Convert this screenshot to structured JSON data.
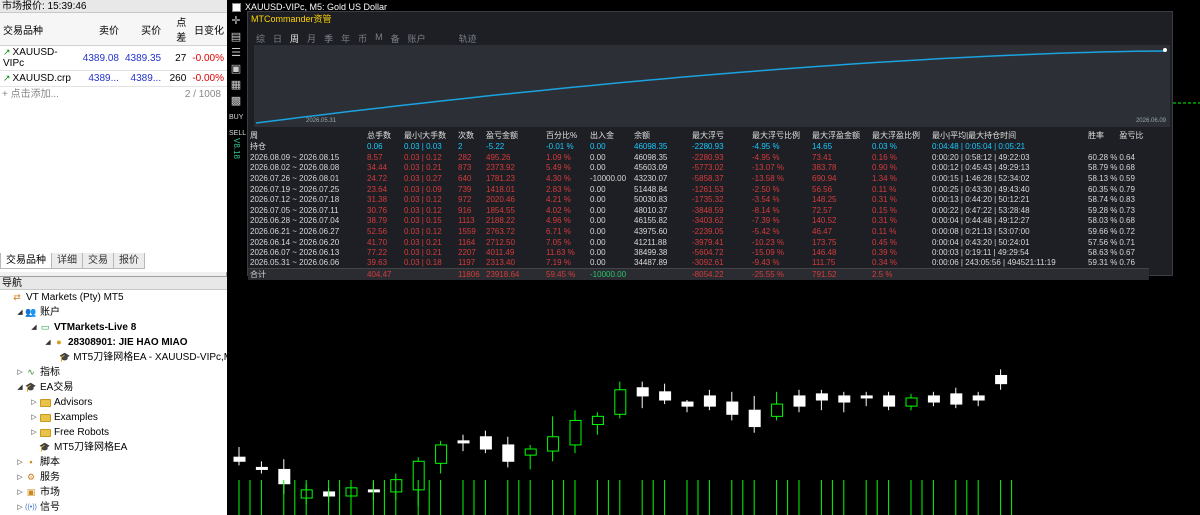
{
  "market_watch": {
    "title": "市场报价: 15:39:46",
    "columns": [
      "交易品种",
      "卖价",
      "买价",
      "点差",
      "日变化"
    ],
    "rows": [
      {
        "symbol": "XAUUSD-VIPc",
        "bid": "4389.08",
        "ask": "4389.35",
        "spread": "27",
        "change": "-0.00%"
      },
      {
        "symbol": "XAUUSD.crp",
        "bid": "4389...",
        "ask": "4389...",
        "spread": "260",
        "change": "-0.00%"
      }
    ],
    "add_label": "点击添加...",
    "count": "2 / 1008",
    "tabs": [
      "交易品种",
      "详细",
      "交易",
      "报价"
    ]
  },
  "navigator": {
    "title": "导航",
    "items": [
      {
        "label": "VT Markets (Pty) MT5",
        "level": 0,
        "icon": "broker-icon"
      },
      {
        "label": "账户",
        "level": 1,
        "icon": "accounts-icon",
        "expand": "▲"
      },
      {
        "label": "VTMarkets-Live 8",
        "level": 2,
        "icon": "server-icon",
        "expand": "▲",
        "bold": true
      },
      {
        "label": "28308901: JIE HAO MIAO",
        "level": 3,
        "icon": "user-icon",
        "expand": "▲",
        "bold": true
      },
      {
        "label": "MT5刀锋网格EA - XAUUSD-VIPc,M",
        "level": 4,
        "icon": "ea-icon"
      },
      {
        "label": "指标",
        "level": 1,
        "icon": "indicator-icon",
        "expand": "▶"
      },
      {
        "label": "EA交易",
        "level": 1,
        "icon": "ea-folder-icon",
        "expand": "▲"
      },
      {
        "label": "Advisors",
        "level": 2,
        "icon": "folder-icon",
        "expand": "▶"
      },
      {
        "label": "Examples",
        "level": 2,
        "icon": "folder-icon",
        "expand": "▶"
      },
      {
        "label": "Free Robots",
        "level": 2,
        "icon": "folder-icon",
        "expand": "▶"
      },
      {
        "label": "MT5刀锋网格EA",
        "level": 2,
        "icon": "ea-icon"
      },
      {
        "label": "脚本",
        "level": 1,
        "icon": "script-icon",
        "expand": "▶"
      },
      {
        "label": "服务",
        "level": 1,
        "icon": "service-icon",
        "expand": "▶"
      },
      {
        "label": "市场",
        "level": 1,
        "icon": "market-icon",
        "expand": "▶"
      },
      {
        "label": "信号",
        "level": 1,
        "icon": "signal-icon",
        "expand": "▶"
      }
    ]
  },
  "chart": {
    "title": "XAUUSD-VIPc, M5:  Gold US Dollar",
    "version": "V8.18",
    "toolstrip": [
      "crosshair-icon",
      "chart-icon",
      "list-icon",
      "expand-icon",
      "calendar-icon",
      "grid-icon"
    ],
    "toolstrip_labels": [
      "BUY",
      "SELL"
    ],
    "colors": {
      "bull": "#00ff00",
      "bear": "#ffffff",
      "equity": "#1aa3e0",
      "loss": "#d63b3b",
      "positive": "#18c9ff"
    }
  },
  "mtc": {
    "title": "MTCommander资管",
    "period_tabs": [
      "综",
      "日",
      "周",
      "月",
      "季",
      "年",
      "币",
      "M",
      "备",
      "账户",
      "轨迹"
    ],
    "active_tab": "周",
    "equity_dates": [
      "2026.05.31",
      "2026.06.09"
    ],
    "headers": [
      "周",
      "总手数",
      "最小|大手数",
      "次数",
      "盈亏金额",
      "百分比%",
      "出入金",
      "余额",
      "最大浮亏",
      "最大浮亏比例",
      "最大浮盈金额",
      "最大浮盈比例",
      "最小|平均|最大持仓时间",
      "胜率",
      "盈亏比"
    ],
    "hold": [
      "持仓",
      "0.06",
      "0.03 | 0.03",
      "2",
      "-5.22",
      "-0.01 %",
      "0.00",
      "46098.35",
      "-2280.93",
      "-4.95 %",
      "14.65",
      "0.03 %",
      "0:04:48 | 0:05:04 | 0:05:21",
      "",
      ""
    ],
    "rows": [
      [
        "2026.08.09 ~ 2026.08.15",
        "8.57",
        "0.03 | 0.12",
        "282",
        "495.26",
        "1.09 %",
        "0.00",
        "46098.35",
        "-2280.93",
        "-4.95 %",
        "73.41",
        "0.16 %",
        "0:00:20 | 0:58:12 | 49:22:03",
        "60.28 %",
        "0.64"
      ],
      [
        "2026.08.02 ~ 2026.08.08",
        "34.44",
        "0.03 | 0.21",
        "873",
        "2373.92",
        "5.49 %",
        "0.00",
        "45603.09",
        "-5773.02",
        "-13.07 %",
        "383.78",
        "0.90 %",
        "0:00:12 | 0:45:43 | 49:29:13",
        "58.79 %",
        "0.68"
      ],
      [
        "2026.07.26 ~ 2026.08.01",
        "24.72",
        "0.03 | 0.27",
        "640",
        "1781.23",
        "4.30 %",
        "-10000.00",
        "43230.07",
        "-5858.37",
        "-13.58 %",
        "690.94",
        "1.34 %",
        "0:00:15 | 1:46:28 | 52:34:02",
        "58.13 %",
        "0.59"
      ],
      [
        "2026.07.19 ~ 2026.07.25",
        "23.64",
        "0.03 | 0.09",
        "739",
        "1418.01",
        "2.83 %",
        "0.00",
        "51448.84",
        "-1261.53",
        "-2.50 %",
        "56.56",
        "0.11 %",
        "0:00:25 | 0:43:30 | 49:43:40",
        "60.35 %",
        "0.79"
      ],
      [
        "2026.07.12 ~ 2026.07.18",
        "31.38",
        "0.03 | 0.12",
        "972",
        "2020.46",
        "4.21 %",
        "0.00",
        "50030.83",
        "-1735.32",
        "-3.54 %",
        "148.25",
        "0.31 %",
        "0:00:13 | 0:44:20 | 50:12:21",
        "58.74 %",
        "0.83"
      ],
      [
        "2026.07.05 ~ 2026.07.11",
        "30.76",
        "0.03 | 0.12",
        "916",
        "1854.55",
        "4.02 %",
        "0.00",
        "48010.37",
        "-3848.59",
        "-8.14 %",
        "72.57",
        "0.15 %",
        "0:00:22 | 0:47:22 | 53:28:48",
        "59.28 %",
        "0.73"
      ],
      [
        "2026.06.28 ~ 2026.07.04",
        "38.79",
        "0.03 | 0.15",
        "1113",
        "2188.22",
        "4.96 %",
        "0.00",
        "46155.82",
        "-3403.62",
        "-7.39 %",
        "140.52",
        "0.31 %",
        "0:00:04 | 0:44:48 | 49:12:27",
        "58.03 %",
        "0.68"
      ],
      [
        "2026.06.21 ~ 2026.06.27",
        "52.56",
        "0.03 | 0.12",
        "1559",
        "2763.72",
        "6.71 %",
        "0.00",
        "43975.60",
        "-2239.05",
        "-5.42 %",
        "46.47",
        "0.11 %",
        "0:00:08 | 0:21:13 | 53:07:00",
        "59.66 %",
        "0.72"
      ],
      [
        "2026.06.14 ~ 2026.06.20",
        "41.70",
        "0.03 | 0.21",
        "1164",
        "2712.50",
        "7.05 %",
        "0.00",
        "41211.88",
        "-3979.41",
        "-10.23 %",
        "173.75",
        "0.45 %",
        "0:00:04 | 0:43:20 | 50:24:01",
        "57.56 %",
        "0.71"
      ],
      [
        "2026.06.07 ~ 2026.06.13",
        "77.22",
        "0.03 | 0.21",
        "2207",
        "4011.49",
        "11.63 %",
        "0.00",
        "38499.38",
        "-5604.72",
        "-15.09 %",
        "146.48",
        "0.39 %",
        "0:00:03 | 0:19:11 | 49:29:54",
        "58.63 %",
        "0.67"
      ],
      [
        "2026.05.31 ~ 2026.06.06",
        "39.63",
        "0.03 | 0.18",
        "1197",
        "2313.40",
        "7.19 %",
        "0.00",
        "34487.89",
        "-3092.61",
        "-9.43 %",
        "111.75",
        "0.34 %",
        "0:00:06 | 243:05:56 | 494521:11:19",
        "59.31 %",
        "0.76"
      ]
    ],
    "total": [
      "合计",
      "404.47",
      "",
      "11806",
      "23918.64",
      "59.45 %",
      "-10000.00",
      "",
      "-8054.22",
      "-25.55 %",
      "791.52",
      "2.5 %",
      "",
      "",
      ""
    ]
  },
  "candles": [
    {
      "o": 0.28,
      "c": 0.3,
      "h": 0.23,
      "l": 0.32,
      "bull": false
    },
    {
      "o": 0.33,
      "c": 0.34,
      "h": 0.3,
      "l": 0.36,
      "bull": false
    },
    {
      "o": 0.34,
      "c": 0.41,
      "h": 0.29,
      "l": 0.46,
      "bull": false
    },
    {
      "o": 0.44,
      "c": 0.48,
      "h": 0.41,
      "l": 0.51,
      "bull": true
    },
    {
      "o": 0.45,
      "c": 0.47,
      "h": 0.43,
      "l": 0.5,
      "bull": false
    },
    {
      "o": 0.43,
      "c": 0.47,
      "h": 0.41,
      "l": 0.5,
      "bull": true
    },
    {
      "o": 0.44,
      "c": 0.44,
      "h": 0.4,
      "l": 0.49,
      "bull": false
    },
    {
      "o": 0.39,
      "c": 0.45,
      "h": 0.36,
      "l": 0.49,
      "bull": true
    },
    {
      "o": 0.3,
      "c": 0.44,
      "h": 0.28,
      "l": 0.52,
      "bull": true
    },
    {
      "o": 0.22,
      "c": 0.31,
      "h": 0.2,
      "l": 0.36,
      "bull": true
    },
    {
      "o": 0.2,
      "c": 0.21,
      "h": 0.17,
      "l": 0.25,
      "bull": false
    },
    {
      "o": 0.18,
      "c": 0.24,
      "h": 0.15,
      "l": 0.26,
      "bull": false
    },
    {
      "o": 0.22,
      "c": 0.3,
      "h": 0.18,
      "l": 0.33,
      "bull": false
    },
    {
      "o": 0.24,
      "c": 0.27,
      "h": 0.22,
      "l": 0.34,
      "bull": true
    },
    {
      "o": 0.18,
      "c": 0.25,
      "h": 0.08,
      "l": 0.3,
      "bull": true
    },
    {
      "o": 0.1,
      "c": 0.22,
      "h": 0.05,
      "l": 0.26,
      "bull": true
    },
    {
      "o": 0.08,
      "c": 0.12,
      "h": 0.06,
      "l": 0.17,
      "bull": true
    },
    {
      "o": -0.05,
      "c": 0.07,
      "h": -0.09,
      "l": 0.09,
      "bull": true
    },
    {
      "o": -0.06,
      "c": -0.02,
      "h": -0.09,
      "l": 0.04,
      "bull": false
    },
    {
      "o": -0.04,
      "c": 0.0,
      "h": -0.08,
      "l": 0.02,
      "bull": false
    },
    {
      "o": 0.01,
      "c": 0.03,
      "h": 0.0,
      "l": 0.06,
      "bull": false
    },
    {
      "o": -0.02,
      "c": 0.03,
      "h": -0.05,
      "l": 0.05,
      "bull": false
    },
    {
      "o": 0.01,
      "c": 0.07,
      "h": -0.04,
      "l": 0.1,
      "bull": false
    },
    {
      "o": 0.05,
      "c": 0.13,
      "h": -0.02,
      "l": 0.16,
      "bull": false
    },
    {
      "o": 0.02,
      "c": 0.08,
      "h": -0.04,
      "l": 0.1,
      "bull": true
    },
    {
      "o": -0.02,
      "c": 0.03,
      "h": -0.05,
      "l": 0.06,
      "bull": false
    },
    {
      "o": -0.03,
      "c": 0.0,
      "h": -0.05,
      "l": 0.05,
      "bull": false
    },
    {
      "o": -0.02,
      "c": 0.01,
      "h": -0.04,
      "l": 0.06,
      "bull": false
    },
    {
      "o": -0.02,
      "c": -0.01,
      "h": -0.04,
      "l": 0.03,
      "bull": false
    },
    {
      "o": -0.02,
      "c": 0.03,
      "h": -0.04,
      "l": 0.05,
      "bull": false
    },
    {
      "o": -0.01,
      "c": 0.03,
      "h": -0.03,
      "l": 0.05,
      "bull": true
    },
    {
      "o": -0.02,
      "c": 0.01,
      "h": -0.04,
      "l": 0.03,
      "bull": false
    },
    {
      "o": -0.03,
      "c": 0.02,
      "h": -0.06,
      "l": 0.04,
      "bull": false
    },
    {
      "o": -0.02,
      "c": 0.0,
      "h": -0.04,
      "l": 0.03,
      "bull": false
    },
    {
      "o": -0.12,
      "c": -0.08,
      "h": -0.15,
      "l": -0.05,
      "bull": false
    }
  ]
}
